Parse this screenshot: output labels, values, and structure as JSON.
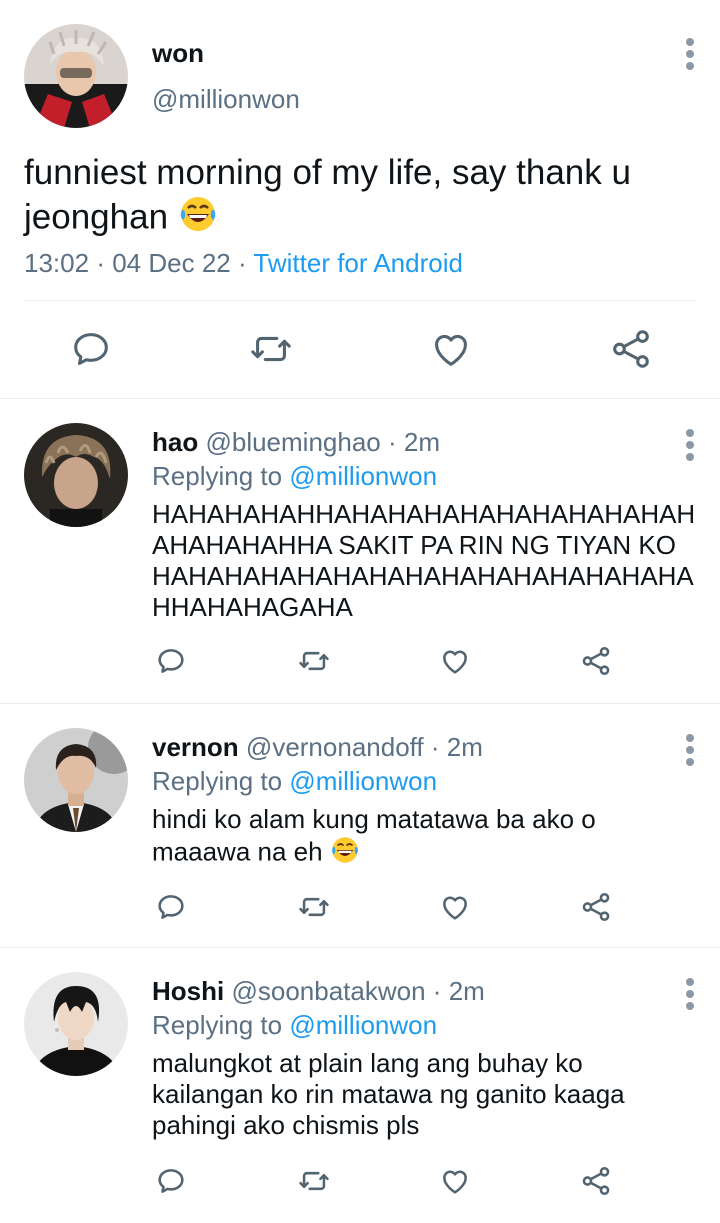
{
  "main_tweet": {
    "name": "won",
    "handle": "@millionwon",
    "text": "funniest morning of my life, say thank u jeonghan",
    "emoji": "face-with-tears-of-joy",
    "time": "13:02",
    "date": "04 Dec 22",
    "source": "Twitter for Android",
    "separator": "·"
  },
  "replies": [
    {
      "name": "hao",
      "handle": "@blueminghao",
      "age": "2m",
      "replying_label": "Replying to",
      "replying_to": "@millionwon",
      "text": "HAHAHAHAHHAHAHAHAHAHAHAHAHAHAH AHAHAHAHHA SAKIT PA RIN NG TIYAN KO HAHAHAHAHAHAHAHAHAHAHAHAHAHAHA HHAHAHAGAHA"
    },
    {
      "name": "vernon",
      "handle": "@vernonandoff",
      "age": "2m",
      "replying_label": "Replying to",
      "replying_to": "@millionwon",
      "text": "hindi ko alam kung matatawa ba ako o maaawa na eh"
    },
    {
      "name": "Hoshi",
      "handle": "@soonbatakwon",
      "age": "2m",
      "replying_label": "Replying to",
      "replying_to": "@millionwon",
      "text": "malungkot at plain lang ang buhay ko kailangan ko rin matawa ng ganito kaaga pahingi ako chismis pls"
    }
  ],
  "icons": [
    "reply-icon",
    "retweet-icon",
    "like-icon",
    "share-icon",
    "more-vertical-icon"
  ],
  "colors": {
    "text": "#0f1419",
    "muted": "#5b7083",
    "link": "#1d9bf0",
    "icon": "#536471",
    "divider": "#e6ecf0"
  }
}
